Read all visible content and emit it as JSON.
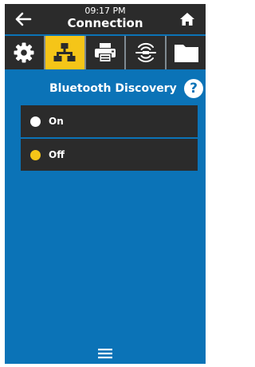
{
  "topbar": {
    "time": "09:17 PM",
    "title": "Connection",
    "back_icon": "arrow-left-icon",
    "home_icon": "home-icon"
  },
  "tabs": [
    {
      "name": "settings",
      "icon": "gear-icon",
      "active": false
    },
    {
      "name": "network",
      "icon": "network-icon",
      "active": true
    },
    {
      "name": "print",
      "icon": "printer-icon",
      "active": false
    },
    {
      "name": "rfid",
      "icon": "rfid-icon",
      "active": false
    },
    {
      "name": "storage",
      "icon": "folder-icon",
      "active": false
    }
  ],
  "section": {
    "title": "Bluetooth Discovery",
    "help_icon": "help-icon",
    "help_glyph": "?"
  },
  "options": [
    {
      "label": "On",
      "selected": false
    },
    {
      "label": "Off",
      "selected": true
    }
  ],
  "footer": {
    "menu_icon": "hamburger-menu-icon"
  },
  "colors": {
    "background": "#0b73b7",
    "bar": "#2b2b2b",
    "accent": "#f5c518"
  }
}
